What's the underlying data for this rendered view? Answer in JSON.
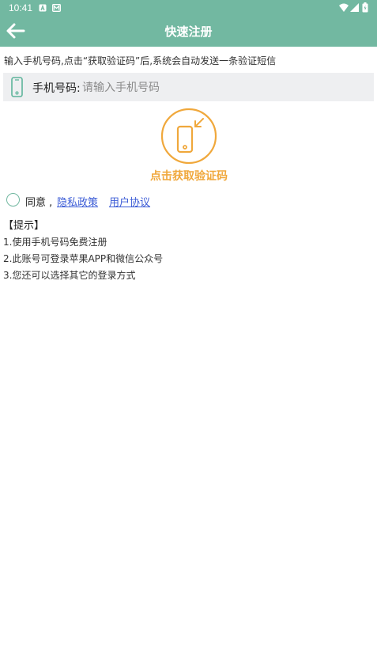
{
  "status_bar": {
    "time": "10:41",
    "icons": [
      "notification-a-icon",
      "notification-mail-icon",
      "wifi-icon",
      "signal-icon",
      "battery-icon"
    ]
  },
  "header": {
    "title": "快速注册",
    "back_icon": "arrow-left-icon"
  },
  "instruction": "输入手机号码,点击“获取验证码”后,系统会自动发送一条验证短信",
  "phone_field": {
    "label": "手机号码:",
    "placeholder": "请输入手机号码",
    "value": ""
  },
  "get_code": {
    "label": "点击获取验证码"
  },
  "agreement": {
    "agree_text": "同意 ,",
    "privacy_link": "隐私政策",
    "terms_link": "用户协议",
    "checked": false
  },
  "tips": {
    "title": "【提示】",
    "items": [
      "1.使用手机号码免费注册",
      "2.此账号可登录苹果APP和微信公众号",
      "3.您还可以选择其它的登录方式"
    ]
  },
  "colors": {
    "header": "#72b8a1",
    "accent_orange": "#f0a83c",
    "link": "#3c5cd6",
    "input_bg": "#eeeff1"
  }
}
